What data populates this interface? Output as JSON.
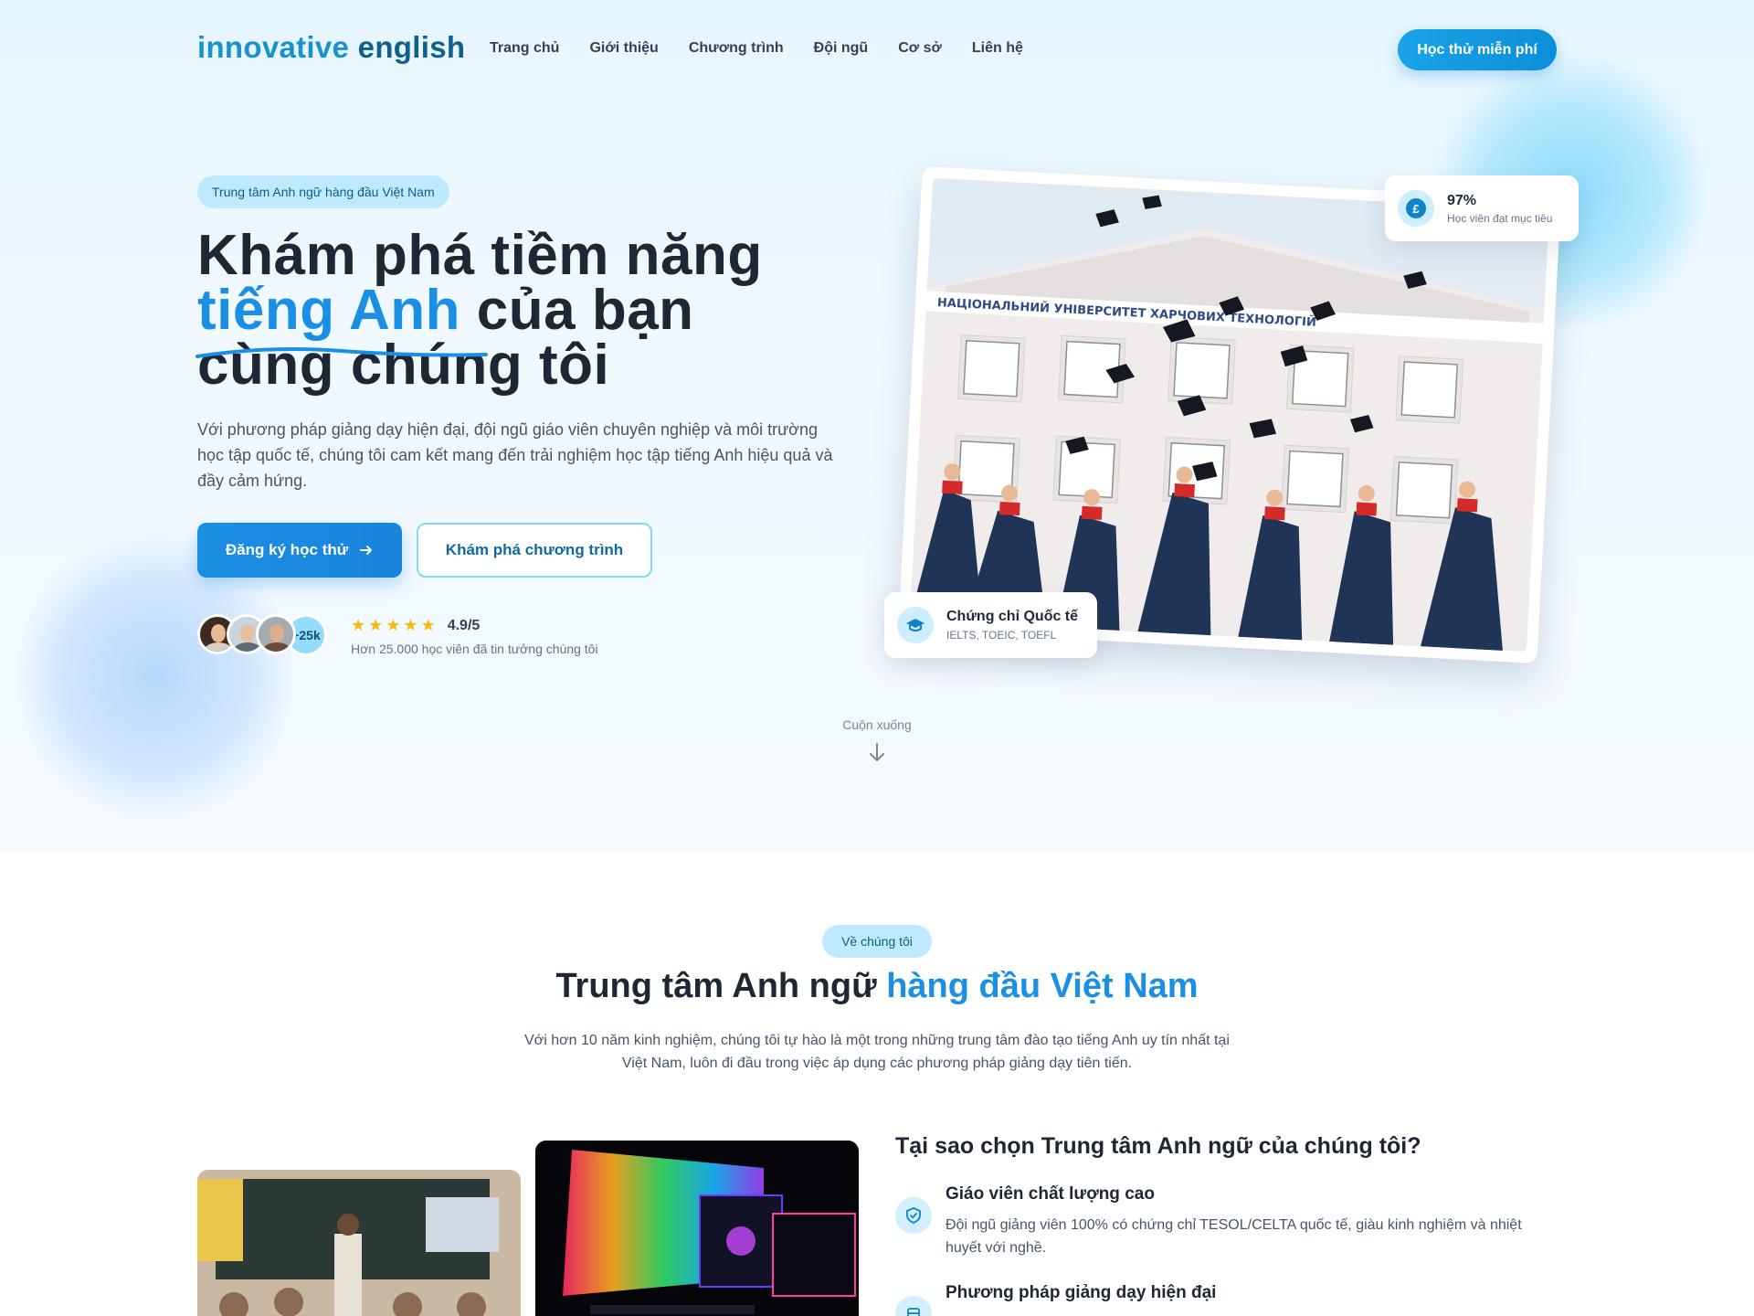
{
  "brand": {
    "logo_part1": "innovative",
    "logo_part2": " english"
  },
  "nav": {
    "items": [
      "Trang chủ",
      "Giới thiệu",
      "Chương trình",
      "Đội ngũ",
      "Cơ sở",
      "Liên hệ"
    ],
    "cta": "Học thử miễn phí"
  },
  "hero": {
    "badge": "Trung tâm Anh ngữ hàng đầu Việt Nam",
    "title_line1": "Khám phá tiềm năng",
    "title_highlight": "tiếng Anh",
    "title_line2_rest": " của bạn",
    "title_line3": "cùng chúng tôi",
    "description": "Với phương pháp giảng dạy hiện đại, đội ngũ giáo viên chuyên nghiệp và môi trường học tập quốc tế, chúng tôi cam kết mang đến trải nghiệm học tập tiếng Anh hiệu quả và đầy cảm hứng.",
    "primary_button": "Đăng ký học thử",
    "primary_button_icon": "arrow-right-icon",
    "secondary_button": "Khám phá chương trình",
    "avatar_count": "+25k",
    "rating": "4.9/5",
    "stars": 5,
    "trust_text": "Hơn 25.000 học viên đã tin tưởng chúng tôi",
    "stat_value": "97%",
    "stat_label": "Học viên đạt mục tiêu",
    "cert_title": "Chứng chỉ Quốc tế",
    "cert_sub": "IELTS, TOEIC, TOEFL",
    "scroll_label": "Cuộn xuống",
    "image_banner_text": "НАЦІОНАЛЬНИЙ УНІВЕРСИТЕТ ХАРЧОВИХ ТЕХНОЛОГІЙ"
  },
  "about": {
    "badge": "Về chúng tôi",
    "title_part1": "Trung tâm Anh ngữ ",
    "title_highlight": "hàng đầu Việt Nam",
    "description": "Với hơn 10 năm kinh nghiệm, chúng tôi tự hào là một trong những trung tâm đào tạo tiếng Anh uy tín nhất tại Việt Nam, luôn đi đầu trong việc áp dụng các phương pháp giảng dạy tiên tiến.",
    "why_title": "Tại sao chọn Trung tâm Anh ngữ của chúng tôi?",
    "features": [
      {
        "title": "Giáo viên chất lượng cao",
        "desc": "Đội ngũ giảng viên 100% có chứng chỉ TESOL/CELTA quốc tế, giàu kinh nghiệm và nhiệt huyết với nghề.",
        "icon": "shield-check-icon"
      },
      {
        "title": "Phương pháp giảng dạy hiện đại",
        "desc": "",
        "icon": "book-icon"
      }
    ]
  },
  "colors": {
    "accent": "#1b8fe3",
    "brand_dark": "#0f5f8f",
    "pill_bg": "#bfeafd",
    "heading": "#1e2733",
    "star": "#f5b90f"
  }
}
